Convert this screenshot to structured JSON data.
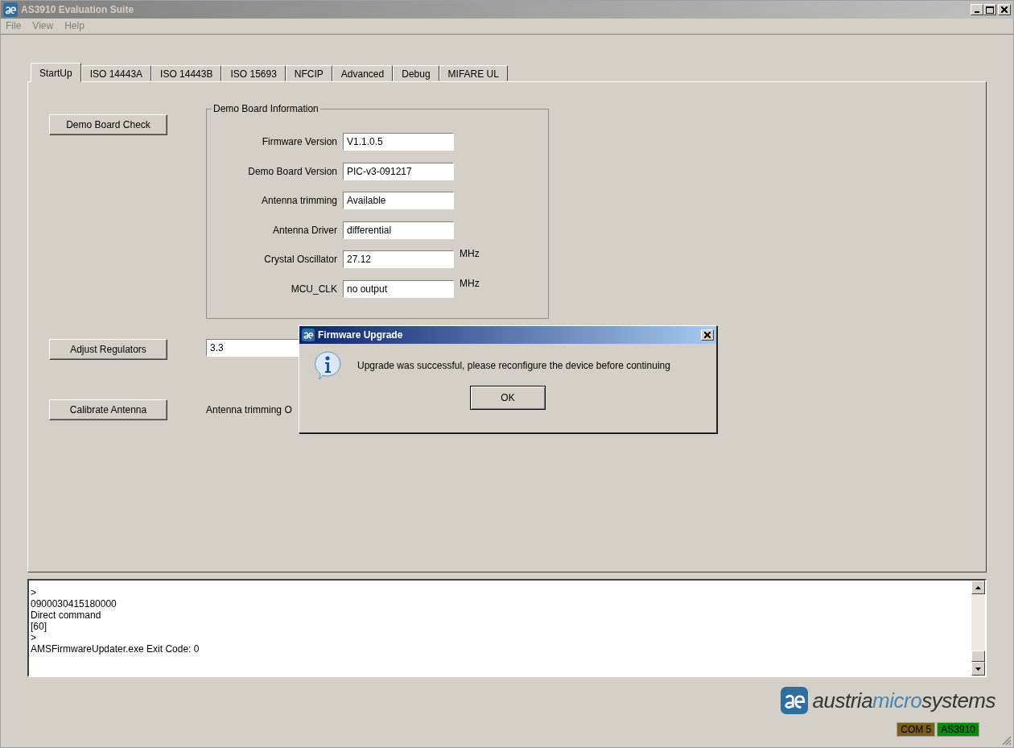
{
  "window": {
    "title": "AS3910 Evaluation Suite",
    "active": false
  },
  "menu": [
    "File",
    "View",
    "Help"
  ],
  "tabs": [
    {
      "label": "StartUp",
      "selected": true
    },
    {
      "label": "ISO 14443A",
      "selected": false
    },
    {
      "label": "ISO 14443B",
      "selected": false
    },
    {
      "label": "ISO 15693",
      "selected": false
    },
    {
      "label": "NFCIP",
      "selected": false
    },
    {
      "label": "Advanced",
      "selected": false
    },
    {
      "label": "Debug",
      "selected": false
    },
    {
      "label": "MIFARE UL",
      "selected": false
    }
  ],
  "startup": {
    "demo_board_check_button": "Demo Board Check",
    "demo_board_info": {
      "title": "Demo Board Information",
      "fields": [
        {
          "label": "Firmware Version",
          "value": "V1.1.0.5"
        },
        {
          "label": "Demo Board Version",
          "value": "PIC-v3-091217"
        },
        {
          "label": "Antenna trimming",
          "value": "Available"
        },
        {
          "label": "Antenna Driver",
          "value": "differential"
        },
        {
          "label": "Crystal Oscillator",
          "value": "27.12",
          "unit": "MHz"
        },
        {
          "label": "MCU_CLK",
          "value": "no output",
          "unit": "MHz"
        }
      ]
    },
    "adjust_regulators_button": "Adjust Regulators",
    "regulator_value": "3.3",
    "calibrate_antenna_button": "Calibrate Antenna",
    "calibration_status": "Antenna trimming O"
  },
  "log": {
    "lines": [
      ">",
      "0900030415180000",
      "Direct command",
      "[60]",
      ">",
      "AMSFirmwareUpdater.exe Exit Code: 0"
    ]
  },
  "logo": {
    "parts": [
      {
        "text": "austria",
        "accent": false
      },
      {
        "text": "micro",
        "accent": true
      },
      {
        "text": "systems",
        "accent": false
      }
    ]
  },
  "status_bar": [
    {
      "text": "COM 5",
      "color": "#7a5c1e"
    },
    {
      "text": "AS3910",
      "color": "#0a8a0a"
    }
  ],
  "dialog": {
    "title": "Firmware Upgrade",
    "active": true,
    "message": "Upgrade was successful, please reconfigure the device before continuing",
    "button": "OK"
  }
}
